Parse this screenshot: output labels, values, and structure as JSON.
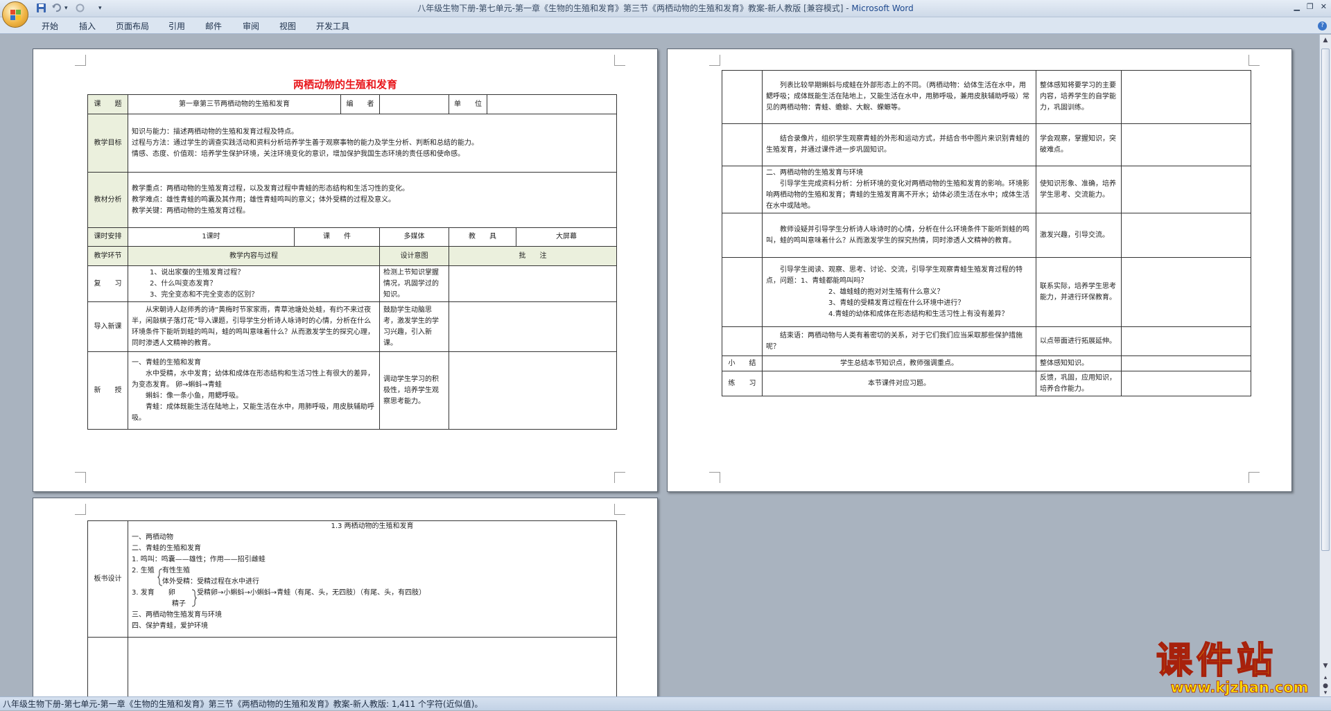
{
  "window": {
    "title_doc": "八年级生物下册-第七单元-第一章《生物的生殖和发育》第三节《两栖动物的生殖和发育》教案-新人教版 [兼容模式] - ",
    "title_app": "Microsoft Word"
  },
  "qat": {
    "redo_symbol": "▾",
    "customize": "▾"
  },
  "ribbon": {
    "tabs": [
      "开始",
      "插入",
      "页面布局",
      "引用",
      "邮件",
      "审阅",
      "视图",
      "开发工具"
    ],
    "help": "?"
  },
  "status": {
    "text": "八年级生物下册-第七单元-第一章《生物的生殖和发育》第三节《两栖动物的生殖和发育》教案-新人教版: 1,411 个字符(近似值)。"
  },
  "page1": {
    "title": "两栖动物的生殖和发育",
    "header_row": {
      "l1": "课　　题",
      "v1": "第一章第三节两栖动物的生殖和发育",
      "l2": "编　　者",
      "v2": "",
      "l3": "单　　位",
      "v3": ""
    },
    "goals": {
      "label": "教学目标",
      "lines": [
        "知识与能力：描述两栖动物的生殖和发育过程及特点。",
        "过程与方法：通过学生的调查实践活动和资料分析培养学生善于观察事物的能力及学生分析、判断和总结的能力。",
        "情感、态度、价值观：培养学生保护环境，关注环境变化的意识，增加保护我国生态环境的责任感和使命感。"
      ]
    },
    "analysis": {
      "label": "教材分析",
      "lines": [
        "教学重点：两栖动物的生殖发育过程，以及发育过程中青蛙的形态结构和生活习性的变化。",
        "教学难点：雄性青蛙的鸣囊及其作用；雄性青蛙鸣叫的意义；体外受精的过程及意义。",
        "教学关键：两栖动物的生殖发育过程。"
      ]
    },
    "schedule": {
      "l1": "课时安排",
      "v1": "1课时",
      "l2": "课　　件",
      "v2": "多媒体",
      "l3": "教　　具",
      "v3": "大屏幕"
    },
    "col_headers": {
      "c1": "教学环节",
      "c2": "教学内容与过程",
      "c3": "设计意图",
      "c4": "批　　注"
    },
    "review": {
      "label": "复　　习",
      "lines": [
        "1、说出家蚕的生殖发育过程？",
        "2、什么叫变态发育？",
        "3、完全变态和不完全变态的区别？"
      ],
      "intent": "检测上节知识掌握情况，巩固学过的知识。"
    },
    "intro": {
      "label": "导入新课",
      "text": "从宋朝诗人赵师秀的诗“黄梅时节家家雨，青草池塘处处蛙，有约不来过夜半，闲敲棋子落灯花”导入课题，引导学生分析诗人咏诗时的心情，分析在什么环境条件下能听到蛙的鸣叫，蛙的鸣叫意味着什么？从而激发学生的探究心理，同时渗透人文精神的教育。",
      "intent": "鼓励学生动脑思考，激发学生的学习兴趣，引入新课。"
    },
    "new": {
      "label": "新　　授",
      "lines": [
        "一、青蛙的生殖和发育",
        "水中受精，水中发育；幼体和成体在形态结构和生活习性上有很大的差异，为变态发育。 卵→蝌蚪→青蛙",
        "蝌蚪：像一条小鱼，用鳃呼吸。",
        "青蛙：成体既能生活在陆地上，又能生活在水中，用肺呼吸，用皮肤辅助呼吸。"
      ],
      "intent": "调动学生学习的积极性，培养学生观察思考能力。"
    }
  },
  "page2": {
    "rows": [
      {
        "label": "",
        "text": "列表比较早期蝌蚪与成蛙在外部形态上的不同。（两栖动物：幼体生活在水中，用鳃呼吸；成体既能生活在陆地上，又能生活在水中，用肺呼吸，兼用皮肤辅助呼吸）常见的两栖动物：青蛙、蟾蜍、大鲵、蝾螈等。",
        "intent": "整体感知将要学习的主要内容，培养学生的自学能力，巩固训练。"
      },
      {
        "label": "",
        "text": "结合录像片，组织学生观察青蛙的外形和运动方式，并结合书中图片来识别青蛙的生殖发育，并通过课件进一步巩固知识。",
        "intent": "学会观察，掌握知识，突破难点。"
      },
      {
        "label": "",
        "text": "二、两栖动物的生殖发育与环境",
        "text2": "引导学生完成资料分析：分析环境的变化对两栖动物的生殖和发育的影响。环境影响两栖动物的生殖和发育；青蛙的生殖发育离不开水；幼体必须生活在水中；成体生活在水中或陆地。",
        "intent": "使知识形象、准确，培养学生思考、交流能力。"
      },
      {
        "label": "",
        "text": "教师设疑并引导学生分析诗人咏诗时的心情，分析在什么环境条件下能听到蛙的鸣叫，蛙的鸣叫意味着什么？从而激发学生的探究热情，同时渗透人文精神的教育。",
        "intent": "激发兴趣，引导交流。"
      },
      {
        "label": "",
        "text": "引导学生阅读、观察、思考、讨论、交流，引导学生观察青蛙生殖发育过程的特点，问题：1、青蛙都能鸣叫吗？",
        "qs": [
          "2、雄蛙蛙的抱对对生殖有什么意义？",
          "3、青蛙的受精发育过程在什么环境中进行？",
          "4.青蛙的幼体和成体在形态结构和生活习性上有没有差异？"
        ],
        "intent": "联系实际，培养学生思考能力，并进行环保教育。"
      },
      {
        "label": "",
        "text": "结束语：两栖动物与人类有着密切的关系，对于它们我们应当采取那些保护措施呢？",
        "intent": "以点带面进行拓展延伸。"
      },
      {
        "label": "小　　结",
        "text": "学生总结本节知识点，教师强调重点。",
        "intent": "整体感知知识。"
      },
      {
        "label": "练　　习",
        "text": "本节课件对应习题。",
        "intent": "反馈，巩固，应用知识，培养合作能力。"
      }
    ]
  },
  "page3": {
    "label": "板书设计",
    "title": "1.3 两栖动物的生殖和发育",
    "lines": [
      "一、两栖动物",
      "二、青蛙的生殖和发育",
      "1. 鸣叫：鸣囊——雄性；作用——招引雌蛙",
      "2. 生殖",
      "有性生殖",
      "体外受精：受精过程在水中进行",
      "3. 发育　　卵",
      "受精卵→小蝌蚪→小蝌蚪→青蛙（有尾、头，无四肢）（有尾、头，有四肢）",
      "精子",
      "三、两栖动物生殖发育与环境",
      "四、保护青蛙，爱护环境"
    ]
  },
  "watermark": {
    "name": "课件站",
    "url": "www.kjzhan.com"
  },
  "colors": {
    "title_red": "#e8161b",
    "label_bg": "#ebf0dd",
    "workspace": "#a9b3bf",
    "watermark_yellow": "#f8d900",
    "watermark_outline": "#a7210c"
  }
}
